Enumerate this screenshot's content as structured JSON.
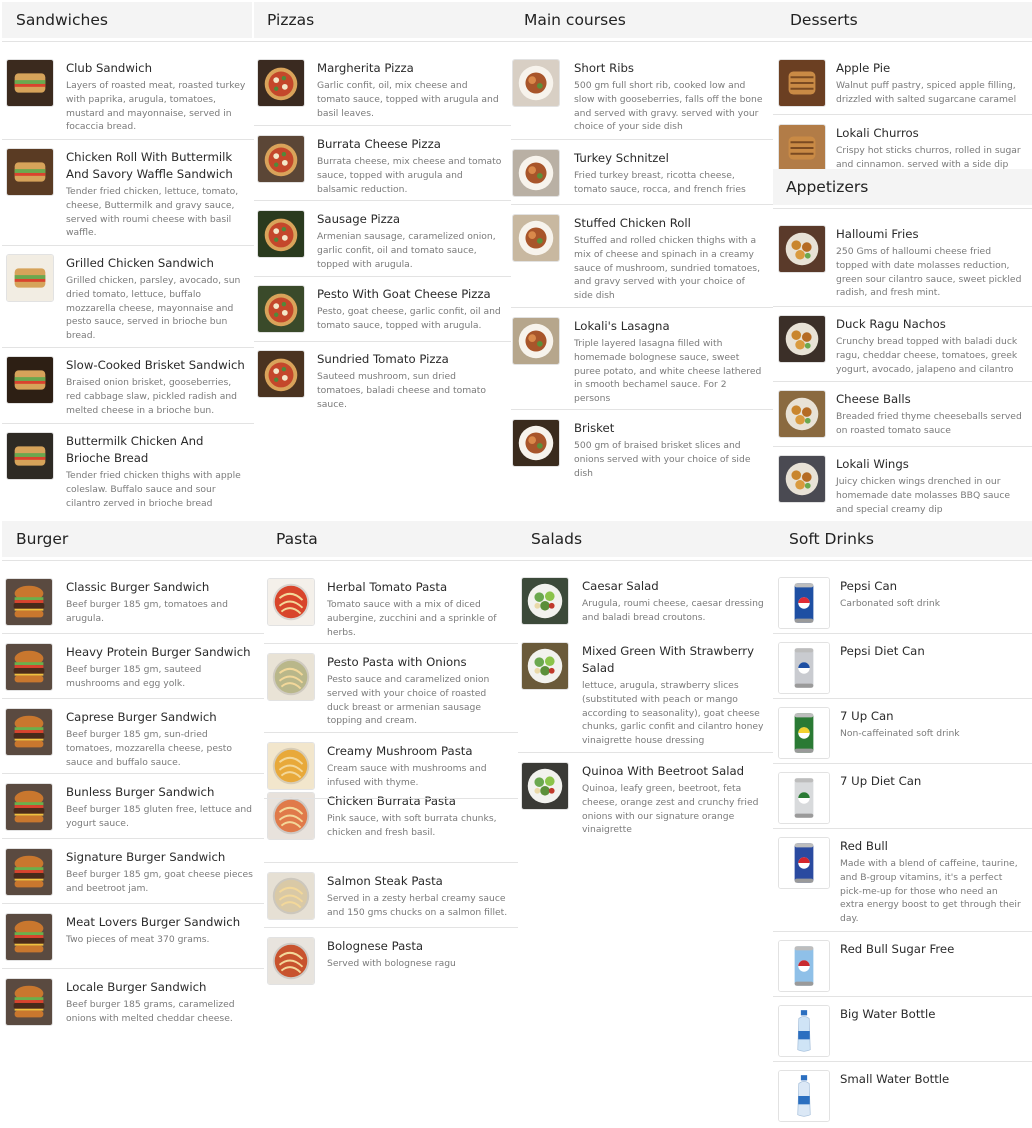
{
  "sections": {
    "sandwiches": {
      "title": "Sandwiches",
      "items": [
        {
          "name": "Club Sandwich",
          "desc": "Layers of roasted meat, roasted turkey with paprika, arugula, tomatoes, mustard and mayonnaise, served in focaccia bread.",
          "img": "sandwich-photo-icon"
        },
        {
          "name": "Chicken Roll With Buttermilk And Savory Waffle Sandwich",
          "desc": "Tender fried chicken, lettuce, tomato, cheese, Buttermilk and gravy sauce, served with roumi cheese with basil waffle.",
          "img": "sandwich-photo-icon"
        },
        {
          "name": "Grilled Chicken Sandwich",
          "desc": "Grilled chicken, parsley, avocado, sun dried tomato, lettuce, buffalo mozzarella cheese, mayonnaise and pesto sauce, served in brioche bun bread.",
          "img": "sandwich-photo-icon"
        },
        {
          "name": "Slow-Cooked Brisket Sandwich",
          "desc": "Braised onion brisket, gooseberries, red cabbage slaw, pickled radish and melted cheese in a brioche bun.",
          "img": "sandwich-photo-icon"
        },
        {
          "name": "Buttermilk Chicken And Brioche Bread",
          "desc": "Tender fried chicken thighs with apple coleslaw. Buffalo sauce and sour cilantro zerved in brioche bread",
          "img": "sandwich-photo-icon"
        }
      ]
    },
    "pizzas": {
      "title": "Pizzas",
      "items": [
        {
          "name": "Margherita Pizza",
          "desc": "Garlic confit, oil, mix cheese and tomato sauce, topped with arugula and basil leaves.",
          "img": "pizza-photo-icon"
        },
        {
          "name": "Burrata Cheese Pizza",
          "desc": "Burrata cheese, mix cheese and tomato sauce, topped with arugula and balsamic reduction.",
          "img": "pizza-photo-icon"
        },
        {
          "name": "Sausage Pizza",
          "desc": "Armenian sausage, caramelized onion, garlic confit, oil and tomato sauce, topped with arugula.",
          "img": "pizza-photo-icon"
        },
        {
          "name": "Pesto With Goat Cheese Pizza",
          "desc": "Pesto, goat cheese, garlic confit, oil and tomato sauce, topped with arugula.",
          "img": "pizza-photo-icon"
        },
        {
          "name": "Sundried Tomato Pizza",
          "desc": "Sauteed mushroom, sun dried tomatoes, baladi cheese and tomato sauce.",
          "img": "pizza-photo-icon"
        }
      ]
    },
    "main_courses": {
      "title": "Main courses",
      "items": [
        {
          "name": "Short Ribs",
          "desc": "500 gm full short rib, cooked low and slow with gooseberries, falls off the bone and served with gravy. served with your choice of your side dish",
          "img": "plate-photo-icon"
        },
        {
          "name": "Turkey Schnitzel",
          "desc": "Fried turkey breast, ricotta cheese, tomato sauce, rocca, and french fries",
          "img": "plate-photo-icon"
        },
        {
          "name": "Stuffed Chicken Roll",
          "desc": "Stuffed and rolled chicken thighs with a mix of cheese and spinach in a creamy sauce of mushroom, sundried tomatoes, and gravy served with your choice of side dish",
          "img": "plate-photo-icon"
        },
        {
          "name": "Lokali's Lasagna",
          "desc": "Triple layered lasagna filled with homemade bolognese sauce, sweet puree potato, and white cheese lathered in smooth bechamel sauce. For 2 persons",
          "img": "plate-photo-icon"
        },
        {
          "name": "Brisket",
          "desc": "500 gm of braised brisket slices and onions served with your choice of side dish",
          "img": "plate-photo-icon"
        }
      ]
    },
    "desserts": {
      "title": "Desserts",
      "items": [
        {
          "name": "Apple Pie",
          "desc": "Walnut puff pastry, spiced apple filling, drizzled with salted sugarcane caramel",
          "img": "dessert-photo-icon"
        },
        {
          "name": "Lokali Churros",
          "desc": "Crispy hot sticks churros, rolled in sugar and cinnamon. served with a side dip",
          "img": "dessert-photo-icon"
        }
      ]
    },
    "appetizers": {
      "title": "Appetizers",
      "items": [
        {
          "name": "Halloumi Fries",
          "desc": "250 Gms of halloumi cheese fried topped with date molasses reduction, green sour cilantro sauce, sweet pickled radish, and fresh mint.",
          "img": "appetizer-photo-icon"
        },
        {
          "name": "Duck Ragu Nachos",
          "desc": "Crunchy bread topped with baladi duck ragu, cheddar cheese, tomatoes, greek yogurt, avocado, jalapeno and cilantro",
          "img": "appetizer-photo-icon"
        },
        {
          "name": "Cheese Balls",
          "desc": "Breaded fried thyme cheeseballs served on roasted tomato sauce",
          "img": "appetizer-photo-icon"
        },
        {
          "name": "Lokali Wings",
          "desc": "Juicy chicken wings drenched in our homemade date molasses BBQ sauce and special creamy dip",
          "img": "appetizer-photo-icon"
        }
      ]
    },
    "burger": {
      "title": "Burger",
      "items": [
        {
          "name": "Classic Burger Sandwich",
          "desc": "Beef burger 185 gm, tomatoes and arugula.",
          "img": "burger-photo-icon"
        },
        {
          "name": "Heavy Protein Burger Sandwich",
          "desc": "Beef burger 185 gm, sauteed mushrooms and egg yolk.",
          "img": "burger-photo-icon"
        },
        {
          "name": "Caprese Burger Sandwich",
          "desc": "Beef burger 185 gm, sun-dried tomatoes, mozzarella cheese, pesto sauce and buffalo sauce.",
          "img": "burger-photo-icon"
        },
        {
          "name": "Bunless Burger Sandwich",
          "desc": "Beef burger 185 gluten free, lettuce and yogurt sauce.",
          "img": "burger-photo-icon"
        },
        {
          "name": "Signature Burger Sandwich",
          "desc": "Beef burger 185 gm, goat cheese pieces and beetroot jam.",
          "img": "burger-photo-icon"
        },
        {
          "name": "Meat Lovers Burger Sandwich",
          "desc": "Two pieces of meat 370 grams.",
          "img": "burger-photo-icon"
        },
        {
          "name": "Locale Burger Sandwich",
          "desc": "Beef burger 185 grams, caramelized onions with melted cheddar cheese.",
          "img": "burger-photo-icon"
        }
      ]
    },
    "pasta": {
      "title": "Pasta",
      "items": [
        {
          "name": "Herbal Tomato Pasta",
          "desc": "Tomato sauce with a mix of diced aubergine, zucchini and a sprinkle of herbs.",
          "img": "pasta-photo-icon"
        },
        {
          "name": "Pesto Pasta with Onions",
          "desc": "Pesto sauce and caramelized onion served with your choice of roasted duck breast or armenian sausage topping and cream.",
          "img": "pasta-photo-icon"
        },
        {
          "name": "Creamy Mushroom Pasta",
          "desc": "Cream sauce with mushrooms and infused with thyme.",
          "img": "pasta-photo-icon"
        },
        {
          "name": "Chicken Burrata Pasta",
          "desc": "Pink sauce, with soft burrata chunks, chicken and fresh basil.",
          "img": "pasta-photo-icon"
        },
        {
          "name": "Salmon Steak Pasta",
          "desc": "Served in a zesty herbal creamy sauce and 150 gms chucks on a salmon fillet.",
          "img": "pasta-photo-icon"
        },
        {
          "name": "Bolognese Pasta",
          "desc": "Served with bolognese ragu",
          "img": "pasta-photo-icon"
        }
      ]
    },
    "salads": {
      "title": "Salads",
      "items": [
        {
          "name": "Caesar Salad",
          "desc": "Arugula, roumi cheese, caesar dressing and baladi bread croutons.",
          "img": "salad-photo-icon"
        },
        {
          "name": "Mixed Green With Strawberry Salad",
          "desc": "lettuce, arugula, strawberry slices (substituted with peach or mango according to seasonality), goat cheese chunks, garlic confit and cilantro honey vinaigrette house dressing",
          "img": "salad-photo-icon"
        },
        {
          "name": "Quinoa With Beetroot Salad",
          "desc": "Quinoa, leafy green, beetroot, feta cheese, orange zest and crunchy fried onions with our signature orange vinaigrette",
          "img": "salad-photo-icon"
        }
      ]
    },
    "soft_drinks": {
      "title": "Soft Drinks",
      "items": [
        {
          "name": "Pepsi Can",
          "desc": "Carbonated soft drink",
          "img": "pepsi-can-icon"
        },
        {
          "name": "Pepsi Diet Can",
          "desc": "",
          "img": "pepsi-diet-can-icon"
        },
        {
          "name": "7 Up Can",
          "desc": "Non-caffeinated soft drink",
          "img": "7up-can-icon"
        },
        {
          "name": "7 Up Diet Can",
          "desc": "",
          "img": "7up-diet-can-icon"
        },
        {
          "name": "Red Bull",
          "desc": "Made with a blend of caffeine, taurine, and B-group vitamins, it's a perfect pick-me-up for those who need an extra energy boost to get through their day.",
          "img": "red-bull-can-icon"
        },
        {
          "name": "Red Bull Sugar Free",
          "desc": "",
          "img": "red-bull-sugar-free-can-icon"
        },
        {
          "name": "Big Water Bottle",
          "desc": "",
          "img": "water-bottle-icon"
        },
        {
          "name": "Small Water Bottle",
          "desc": "",
          "img": "water-bottle-icon"
        }
      ]
    }
  }
}
